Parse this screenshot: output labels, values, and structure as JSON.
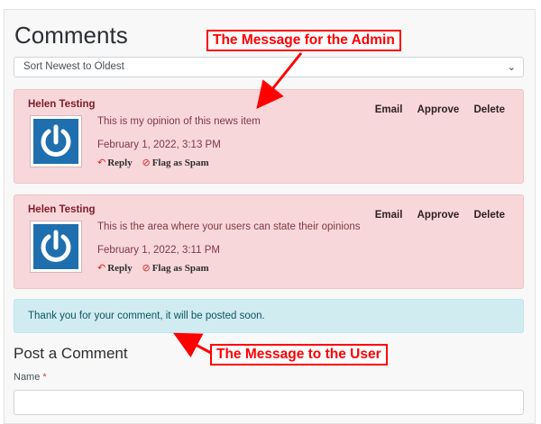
{
  "header": {
    "title": "Comments"
  },
  "sort": {
    "selected": "Sort Newest to Oldest"
  },
  "comments": [
    {
      "author": "Helen Testing",
      "text": "This is my opinion of this news item",
      "date": "February 1, 2022, 3:13 PM",
      "reply_label": "Reply",
      "spam_label": "Flag as Spam",
      "email_label": "Email",
      "approve_label": "Approve",
      "delete_label": "Delete"
    },
    {
      "author": "Helen Testing",
      "text": "This is the area where your users can state their opinions",
      "date": "February 1, 2022, 3:11 PM",
      "reply_label": "Reply",
      "spam_label": "Flag as Spam",
      "email_label": "Email",
      "approve_label": "Approve",
      "delete_label": "Delete"
    }
  ],
  "notice": {
    "text": "Thank you for your comment, it will be posted soon."
  },
  "post_form": {
    "title": "Post a Comment",
    "name_label": "Name",
    "required_mark": "*",
    "name_value": ""
  },
  "annotations": {
    "admin": "The Message for the Admin",
    "user": "The Message to the User"
  },
  "colors": {
    "admin_bg": "#f8d7da",
    "notice_bg": "#d1ecf1",
    "annotation": "#ff0000",
    "avatar": "#1f6fae"
  }
}
